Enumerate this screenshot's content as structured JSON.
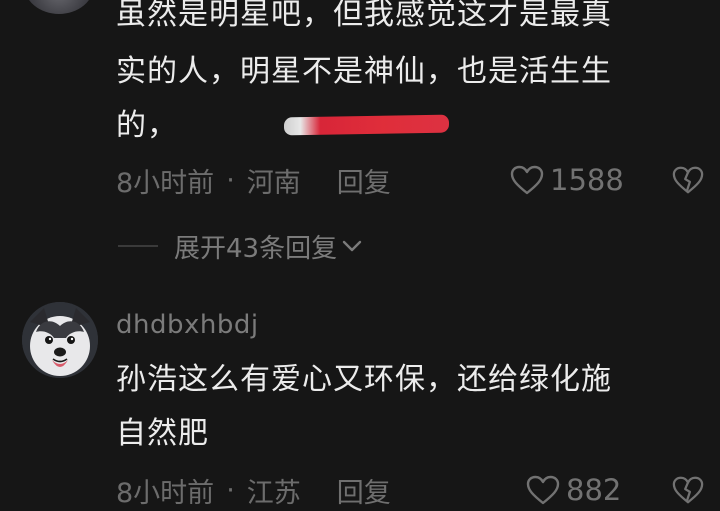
{
  "comments": [
    {
      "lines": [
        "虽然是明星吧，但我感觉这才是最真",
        "实的人，明星不是神仙，也是活生生",
        "的，"
      ],
      "time": "8小时前",
      "separator": "·",
      "location": "河南",
      "reply_label": "回复",
      "likes": "1588",
      "expand_label": "展开43条回复"
    },
    {
      "username": "dhdbxhbdj",
      "lines": [
        "孙浩这么有爱心又环保，还给绿化施",
        "自然肥"
      ],
      "time": "8小时前",
      "separator": "·",
      "location": "江苏",
      "reply_label": "回复",
      "likes": "882"
    }
  ],
  "icons": {
    "like": "heart-outline-icon",
    "dislike": "broken-heart-icon",
    "expand": "chevron-down-icon"
  },
  "colors": {
    "background": "#161616",
    "text": "#ececec",
    "muted": "#6c6c6c"
  }
}
